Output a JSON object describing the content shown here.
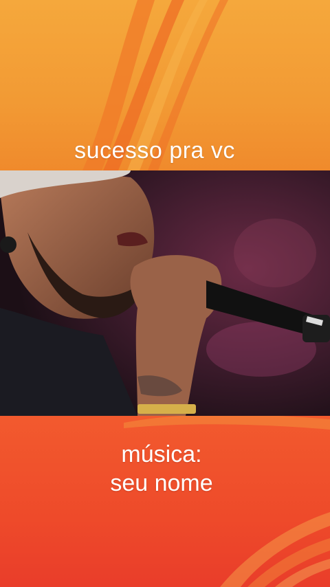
{
  "captions": {
    "top": "sucesso pra vc",
    "bottom_line1": "música:",
    "bottom_line2": "seu nome"
  },
  "colors": {
    "orange_top": "#f5a83c",
    "orange_mid": "#f08a2c",
    "red_bottom": "#e93d2a",
    "text": "#ffffff"
  },
  "photo": {
    "subject": "singer-with-microphone"
  }
}
